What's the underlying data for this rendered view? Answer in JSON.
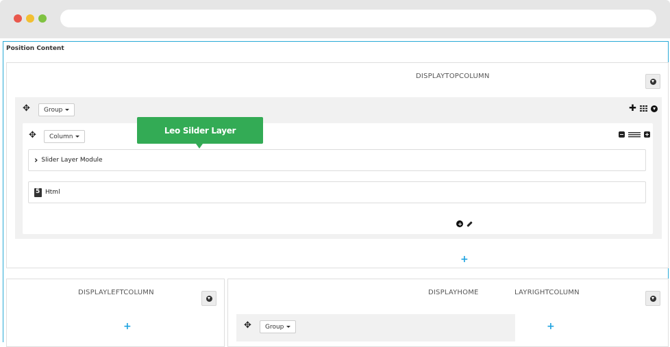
{
  "window": {
    "controls": [
      "close",
      "minimize",
      "maximize"
    ],
    "address_bar": ""
  },
  "page": {
    "title": "Position Content"
  },
  "positions": {
    "top": {
      "label": "DISPLAYTOPCOLUMN",
      "group_label": "Group",
      "column_label": "Column",
      "modules": [
        {
          "name": "Slider Layer Module",
          "icon": "chevron-right-icon"
        },
        {
          "name": "Html",
          "icon": "html5-icon"
        }
      ],
      "tooltip": "Leo Silder Layer"
    },
    "left": {
      "label": "DISPLAYLEFTCOLUMN"
    },
    "home": {
      "label": "DISPLAYHOME",
      "group_label": "Group"
    },
    "right": {
      "label": "LAYRIGHTCOLUMN"
    }
  },
  "colors": {
    "accent_border": "#27a9d6",
    "tooltip_bg": "#33ab55",
    "add_plus": "#1fa3e0"
  }
}
